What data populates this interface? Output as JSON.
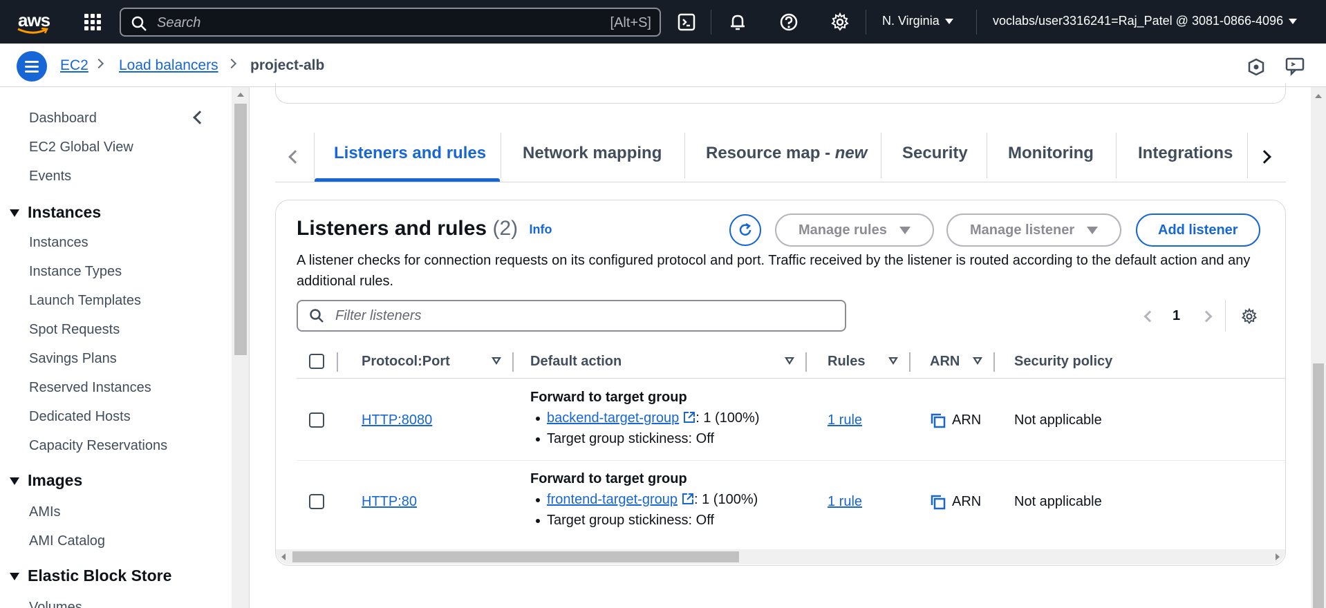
{
  "topnav": {
    "logo": "aws",
    "search_placeholder": "Search",
    "search_shortcut": "[Alt+S]",
    "icons": [
      "apps-grid-icon",
      "cloudshell-icon",
      "bell-icon",
      "help-icon",
      "gear-icon"
    ],
    "region": "N. Virginia",
    "account": "voclabs/user3316241=Raj_Patel @ 3081-0866-4096"
  },
  "breadcrumb": {
    "items": [
      "EC2",
      "Load balancers"
    ],
    "current": "project-alb"
  },
  "sidebar": {
    "top_items": [
      "Dashboard",
      "EC2 Global View",
      "Events"
    ],
    "sections": [
      {
        "title": "Instances",
        "items": [
          "Instances",
          "Instance Types",
          "Launch Templates",
          "Spot Requests",
          "Savings Plans",
          "Reserved Instances",
          "Dedicated Hosts",
          "Capacity Reservations"
        ]
      },
      {
        "title": "Images",
        "items": [
          "AMIs",
          "AMI Catalog"
        ]
      },
      {
        "title": "Elastic Block Store",
        "items": [
          "Volumes"
        ]
      }
    ]
  },
  "tabs": {
    "items": [
      "Listeners and rules",
      "Network mapping",
      "Resource map - ",
      "Security",
      "Monitoring",
      "Integrations"
    ],
    "resource_map_suffix": "new",
    "active": "Listeners and rules"
  },
  "listeners": {
    "title": "Listeners and rules",
    "count": "(2)",
    "info": "Info",
    "description": "A listener checks for connection requests on its configured protocol and port. Traffic received by the listener is routed according to the default action and any additional rules.",
    "buttons": {
      "manage_rules": "Manage rules",
      "manage_listener": "Manage listener",
      "add_listener": "Add listener"
    },
    "filter_placeholder": "Filter listeners",
    "page": "1",
    "columns": [
      "Protocol:Port",
      "Default action",
      "Rules",
      "ARN",
      "Security policy"
    ],
    "rows": [
      {
        "protocol_port": "HTTP:8080",
        "action_title": "Forward to target group",
        "target_group": "backend-target-group",
        "weight": ": 1 (100%)",
        "stickiness": "Target group stickiness: Off",
        "rules": "1 rule",
        "arn": "ARN",
        "security_policy": "Not applicable"
      },
      {
        "protocol_port": "HTTP:80",
        "action_title": "Forward to target group",
        "target_group": "frontend-target-group",
        "weight": ": 1 (100%)",
        "stickiness": "Target group stickiness: Off",
        "rules": "1 rule",
        "arn": "ARN",
        "security_policy": "Not applicable"
      }
    ]
  },
  "colors": {
    "nav_bg": "#161d26",
    "link": "#1766d6",
    "text": "#0f141a",
    "muted": "#414d5c",
    "border": "#d5d9de"
  }
}
